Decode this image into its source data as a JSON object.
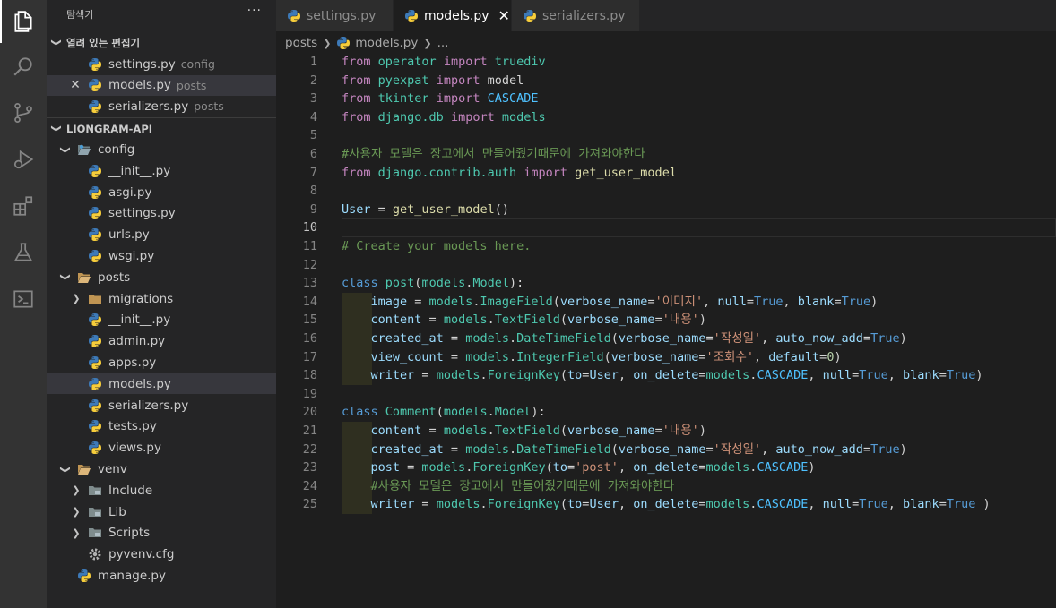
{
  "activity_bar": {
    "items": [
      {
        "name": "explorer-icon",
        "active": true
      },
      {
        "name": "search-icon",
        "active": false
      },
      {
        "name": "source-control-icon",
        "active": false
      },
      {
        "name": "run-debug-icon",
        "active": false
      },
      {
        "name": "extensions-icon",
        "active": false
      },
      {
        "name": "testing-icon",
        "active": false
      },
      {
        "name": "remote-explorer-icon",
        "active": false
      }
    ]
  },
  "sidebar": {
    "title": "탐색기",
    "more": "···",
    "open_editors": {
      "label": "열려 있는 편집기",
      "items": [
        {
          "file": "settings.py",
          "desc": "config"
        },
        {
          "file": "models.py",
          "desc": "posts"
        },
        {
          "file": "serializers.py",
          "desc": "posts"
        }
      ]
    },
    "project": {
      "label": "LIONGRAM-API",
      "tree": [
        {
          "label": "config",
          "type": "folder-open",
          "depth": 1
        },
        {
          "label": "__init__.py",
          "type": "py",
          "depth": 2
        },
        {
          "label": "asgi.py",
          "type": "py",
          "depth": 2
        },
        {
          "label": "settings.py",
          "type": "py",
          "depth": 2
        },
        {
          "label": "urls.py",
          "type": "py",
          "depth": 2
        },
        {
          "label": "wsgi.py",
          "type": "py",
          "depth": 2
        },
        {
          "label": "posts",
          "type": "folder-open",
          "depth": 1
        },
        {
          "label": "migrations",
          "type": "folder-closed",
          "depth": 2
        },
        {
          "label": "__init__.py",
          "type": "py",
          "depth": 2
        },
        {
          "label": "admin.py",
          "type": "py",
          "depth": 2
        },
        {
          "label": "apps.py",
          "type": "py",
          "depth": 2
        },
        {
          "label": "models.py",
          "type": "py",
          "depth": 2
        },
        {
          "label": "serializers.py",
          "type": "py",
          "depth": 2
        },
        {
          "label": "tests.py",
          "type": "py",
          "depth": 2
        },
        {
          "label": "views.py",
          "type": "py",
          "depth": 2
        },
        {
          "label": "venv",
          "type": "folder-open",
          "depth": 1
        },
        {
          "label": "Include",
          "type": "folder-closed",
          "depth": 2
        },
        {
          "label": "Lib",
          "type": "folder-closed",
          "depth": 2
        },
        {
          "label": "Scripts",
          "type": "folder-closed",
          "depth": 2
        },
        {
          "label": "pyvenv.cfg",
          "type": "cfg",
          "depth": 2
        },
        {
          "label": "manage.py",
          "type": "py",
          "depth": 1
        }
      ]
    }
  },
  "tabs": [
    {
      "label": "settings.py",
      "active": false
    },
    {
      "label": "models.py",
      "active": true,
      "close": "✕"
    },
    {
      "label": "serializers.py",
      "active": false
    }
  ],
  "breadcrumb": {
    "folder": "posts",
    "file": "models.py",
    "rest": "..."
  },
  "editor": {
    "current_line": 10,
    "lines": [
      [
        [
          "kw2",
          "from"
        ],
        [
          "",
          " "
        ],
        [
          "cls",
          "operator"
        ],
        [
          "",
          " "
        ],
        [
          "kw2",
          "import"
        ],
        [
          "",
          " "
        ],
        [
          "cls",
          "truediv"
        ]
      ],
      [
        [
          "kw2",
          "from"
        ],
        [
          "",
          " "
        ],
        [
          "cls",
          "pyexpat"
        ],
        [
          "",
          " "
        ],
        [
          "kw2",
          "import"
        ],
        [
          "",
          " "
        ],
        [
          "",
          "model"
        ]
      ],
      [
        [
          "kw2",
          "from"
        ],
        [
          "",
          " "
        ],
        [
          "cls",
          "tkinter"
        ],
        [
          "",
          " "
        ],
        [
          "kw2",
          "import"
        ],
        [
          "",
          " "
        ],
        [
          "const",
          "CASCADE"
        ]
      ],
      [
        [
          "kw2",
          "from"
        ],
        [
          "",
          " "
        ],
        [
          "cls",
          "django.db"
        ],
        [
          "",
          " "
        ],
        [
          "kw2",
          "import"
        ],
        [
          "",
          " "
        ],
        [
          "cls",
          "models"
        ]
      ],
      [],
      [
        [
          "cm",
          "#사용자 모델은 장고에서 만들어줬기때문에 가져와야한다"
        ]
      ],
      [
        [
          "kw2",
          "from"
        ],
        [
          "",
          " "
        ],
        [
          "cls",
          "django.contrib.auth"
        ],
        [
          "",
          " "
        ],
        [
          "kw2",
          "import"
        ],
        [
          "",
          " "
        ],
        [
          "fn",
          "get_user_model"
        ]
      ],
      [],
      [
        [
          "var",
          "User"
        ],
        [
          "",
          " = "
        ],
        [
          "fn",
          "get_user_model"
        ],
        [
          "",
          "()"
        ]
      ],
      [],
      [
        [
          "cm",
          "# Create your models here."
        ]
      ],
      [],
      [
        [
          "kw",
          "class"
        ],
        [
          "",
          " "
        ],
        [
          "cls",
          "post"
        ],
        [
          "",
          "("
        ],
        [
          "cls",
          "models"
        ],
        [
          "",
          "."
        ],
        [
          "cls",
          "Model"
        ],
        [
          "",
          "):"
        ]
      ],
      [
        [
          "",
          "    "
        ],
        [
          "var",
          "image"
        ],
        [
          "",
          " = "
        ],
        [
          "cls",
          "models"
        ],
        [
          "",
          "."
        ],
        [
          "cls",
          "ImageField"
        ],
        [
          "",
          "("
        ],
        [
          "var",
          "verbose_name"
        ],
        [
          "",
          "="
        ],
        [
          "str",
          "'이미지'"
        ],
        [
          "",
          ", "
        ],
        [
          "var",
          "null"
        ],
        [
          "",
          "="
        ],
        [
          "kw",
          "True"
        ],
        [
          "",
          ", "
        ],
        [
          "var",
          "blank"
        ],
        [
          "",
          "="
        ],
        [
          "kw",
          "True"
        ],
        [
          "",
          ")"
        ]
      ],
      [
        [
          "",
          "    "
        ],
        [
          "var",
          "content"
        ],
        [
          "",
          " = "
        ],
        [
          "cls",
          "models"
        ],
        [
          "",
          "."
        ],
        [
          "cls",
          "TextField"
        ],
        [
          "",
          "("
        ],
        [
          "var",
          "verbose_name"
        ],
        [
          "",
          "="
        ],
        [
          "str",
          "'내용'"
        ],
        [
          "",
          ")"
        ]
      ],
      [
        [
          "",
          "    "
        ],
        [
          "var",
          "created_at"
        ],
        [
          "",
          " = "
        ],
        [
          "cls",
          "models"
        ],
        [
          "",
          "."
        ],
        [
          "cls",
          "DateTimeField"
        ],
        [
          "",
          "("
        ],
        [
          "var",
          "verbose_name"
        ],
        [
          "",
          "="
        ],
        [
          "str",
          "'작성일'"
        ],
        [
          "",
          ", "
        ],
        [
          "var",
          "auto_now_add"
        ],
        [
          "",
          "="
        ],
        [
          "kw",
          "True"
        ],
        [
          "",
          ")"
        ]
      ],
      [
        [
          "",
          "    "
        ],
        [
          "var",
          "view_count"
        ],
        [
          "",
          " = "
        ],
        [
          "cls",
          "models"
        ],
        [
          "",
          "."
        ],
        [
          "cls",
          "IntegerField"
        ],
        [
          "",
          "("
        ],
        [
          "var",
          "verbose_name"
        ],
        [
          "",
          "="
        ],
        [
          "str",
          "'조회수'"
        ],
        [
          "",
          ", "
        ],
        [
          "var",
          "default"
        ],
        [
          "",
          "="
        ],
        [
          "num",
          "0"
        ],
        [
          "",
          ")"
        ]
      ],
      [
        [
          "",
          "    "
        ],
        [
          "var",
          "writer"
        ],
        [
          "",
          " = "
        ],
        [
          "cls",
          "models"
        ],
        [
          "",
          "."
        ],
        [
          "cls",
          "ForeignKey"
        ],
        [
          "",
          "("
        ],
        [
          "var",
          "to"
        ],
        [
          "",
          "="
        ],
        [
          "var",
          "User"
        ],
        [
          "",
          ", "
        ],
        [
          "var",
          "on_delete"
        ],
        [
          "",
          "="
        ],
        [
          "cls",
          "models"
        ],
        [
          "",
          "."
        ],
        [
          "const",
          "CASCADE"
        ],
        [
          "",
          ", "
        ],
        [
          "var",
          "null"
        ],
        [
          "",
          "="
        ],
        [
          "kw",
          "True"
        ],
        [
          "",
          ", "
        ],
        [
          "var",
          "blank"
        ],
        [
          "",
          "="
        ],
        [
          "kw",
          "True"
        ],
        [
          "",
          ")"
        ]
      ],
      [],
      [
        [
          "kw",
          "class"
        ],
        [
          "",
          " "
        ],
        [
          "cls",
          "Comment"
        ],
        [
          "",
          "("
        ],
        [
          "cls",
          "models"
        ],
        [
          "",
          "."
        ],
        [
          "cls",
          "Model"
        ],
        [
          "",
          "):"
        ]
      ],
      [
        [
          "",
          "    "
        ],
        [
          "var",
          "content"
        ],
        [
          "",
          " = "
        ],
        [
          "cls",
          "models"
        ],
        [
          "",
          "."
        ],
        [
          "cls",
          "TextField"
        ],
        [
          "",
          "("
        ],
        [
          "var",
          "verbose_name"
        ],
        [
          "",
          "="
        ],
        [
          "str",
          "'내용'"
        ],
        [
          "",
          ")"
        ]
      ],
      [
        [
          "",
          "    "
        ],
        [
          "var",
          "created_at"
        ],
        [
          "",
          " = "
        ],
        [
          "cls",
          "models"
        ],
        [
          "",
          "."
        ],
        [
          "cls",
          "DateTimeField"
        ],
        [
          "",
          "("
        ],
        [
          "var",
          "verbose_name"
        ],
        [
          "",
          "="
        ],
        [
          "str",
          "'작성일'"
        ],
        [
          "",
          ", "
        ],
        [
          "var",
          "auto_now_add"
        ],
        [
          "",
          "="
        ],
        [
          "kw",
          "True"
        ],
        [
          "",
          ")"
        ]
      ],
      [
        [
          "",
          "    "
        ],
        [
          "var",
          "post"
        ],
        [
          "",
          " = "
        ],
        [
          "cls",
          "models"
        ],
        [
          "",
          "."
        ],
        [
          "cls",
          "ForeignKey"
        ],
        [
          "",
          "("
        ],
        [
          "var",
          "to"
        ],
        [
          "",
          "="
        ],
        [
          "str",
          "'post'"
        ],
        [
          "",
          ", "
        ],
        [
          "var",
          "on_delete"
        ],
        [
          "",
          "="
        ],
        [
          "cls",
          "models"
        ],
        [
          "",
          "."
        ],
        [
          "const",
          "CASCADE"
        ],
        [
          "",
          ")"
        ]
      ],
      [
        [
          "",
          "    "
        ],
        [
          "cm",
          "#사용자 모델은 장고에서 만들어줬기때문에 가져와야한다"
        ]
      ],
      [
        [
          "",
          "    "
        ],
        [
          "var",
          "writer"
        ],
        [
          "",
          " = "
        ],
        [
          "cls",
          "models"
        ],
        [
          "",
          "."
        ],
        [
          "cls",
          "ForeignKey"
        ],
        [
          "",
          "("
        ],
        [
          "var",
          "to"
        ],
        [
          "",
          "="
        ],
        [
          "var",
          "User"
        ],
        [
          "",
          ", "
        ],
        [
          "var",
          "on_delete"
        ],
        [
          "",
          "="
        ],
        [
          "cls",
          "models"
        ],
        [
          "",
          "."
        ],
        [
          "const",
          "CASCADE"
        ],
        [
          "",
          ", "
        ],
        [
          "var",
          "null"
        ],
        [
          "",
          "="
        ],
        [
          "kw",
          "True"
        ],
        [
          "",
          ", "
        ],
        [
          "var",
          "blank"
        ],
        [
          "",
          "="
        ],
        [
          "kw",
          "True"
        ],
        [
          "",
          " )"
        ]
      ]
    ]
  }
}
